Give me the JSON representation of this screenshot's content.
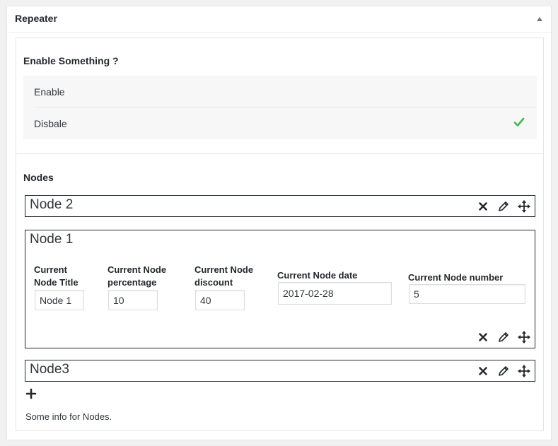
{
  "metabox": {
    "title": "Repeater",
    "toggle_icon": "triangle-up-icon"
  },
  "enable_field": {
    "label": "Enable Something ?",
    "options": [
      {
        "label": "Enable",
        "selected": false
      },
      {
        "label": "Disbale",
        "selected": true
      }
    ],
    "check_color": "#46b450"
  },
  "nodes_field": {
    "label": "Nodes",
    "nodes": [
      {
        "title": "Node 2",
        "expanded": false
      },
      {
        "title": "Node 1",
        "expanded": true,
        "fields": [
          {
            "label_line1": "Current",
            "label_line2": "Node Title",
            "value": "Node 1"
          },
          {
            "label_line1": "Current Node",
            "label_line2": "percentage",
            "value": "10"
          },
          {
            "label_line1": "Current Node",
            "label_line2": "discount",
            "value": "40"
          },
          {
            "label": "Current Node date",
            "value": "2017-02-28"
          },
          {
            "label": "Current Node number",
            "value": "5"
          }
        ]
      },
      {
        "title": "Node3",
        "expanded": false
      }
    ],
    "actions": [
      "close-icon",
      "pencil-icon",
      "move-icon"
    ],
    "info": "Some info for Nodes."
  }
}
